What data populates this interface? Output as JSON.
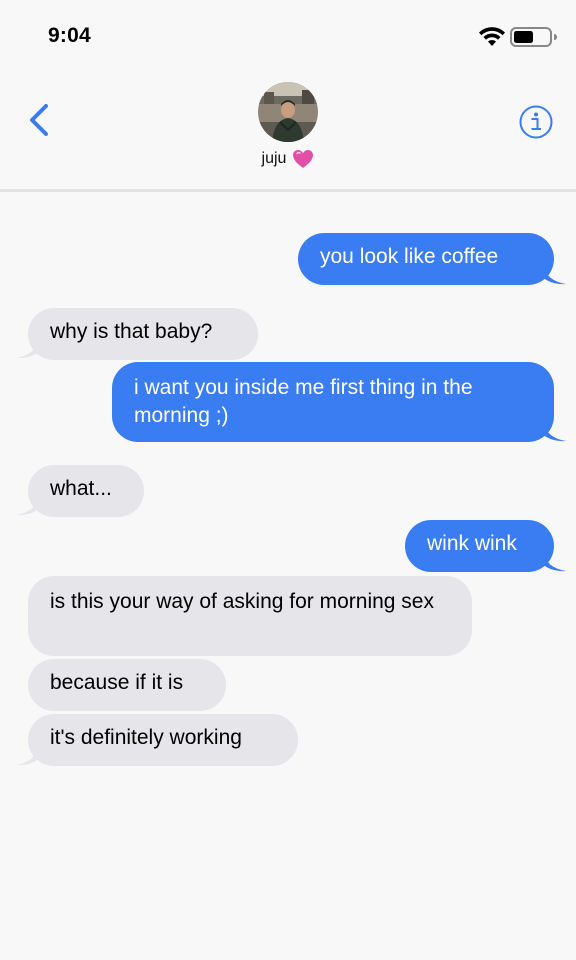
{
  "status_bar": {
    "time": "9:04",
    "icons": [
      "wifi-icon",
      "battery-icon"
    ]
  },
  "header": {
    "back_icon": "chevron-left-icon",
    "contact_name": "juju",
    "contact_emoji": "heart-icon",
    "info_icon": "info-icon"
  },
  "colors": {
    "accent": "#3a7cf2",
    "sent_bubble": "#3a7cf2",
    "received_bubble": "#e5e5ea",
    "background": "#f8f8f8"
  },
  "messages": [
    {
      "direction": "sent",
      "text": "you look like coffee"
    },
    {
      "direction": "received",
      "text": "why is that baby?"
    },
    {
      "direction": "sent",
      "text": "i want you inside me first thing in the morning ;)"
    },
    {
      "direction": "received",
      "text": "what..."
    },
    {
      "direction": "sent",
      "text": "wink wink"
    },
    {
      "direction": "received",
      "text": "is this your way of asking for morning sex"
    },
    {
      "direction": "received",
      "text": "because if it is"
    },
    {
      "direction": "received",
      "text": "it's definitely working"
    }
  ]
}
